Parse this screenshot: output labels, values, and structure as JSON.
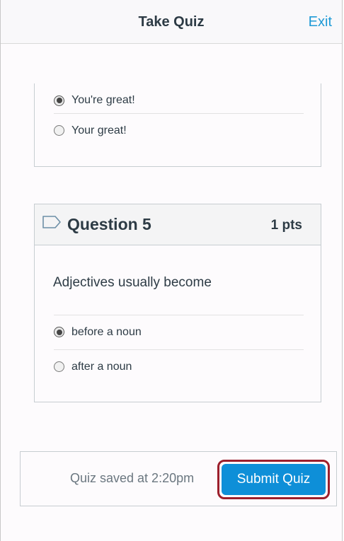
{
  "nav": {
    "title": "Take Quiz",
    "exit_label": "Exit"
  },
  "question4": {
    "answers": [
      {
        "label": "You're great!",
        "selected": true
      },
      {
        "label": "Your great!",
        "selected": false
      }
    ]
  },
  "question5": {
    "title": "Question 5",
    "points": "1 pts",
    "text": "Adjectives usually become",
    "answers": [
      {
        "label": "before a noun",
        "selected": true
      },
      {
        "label": "after a noun",
        "selected": false
      }
    ]
  },
  "footer": {
    "saved_text": "Quiz saved at 2:20pm",
    "submit_label": "Submit Quiz"
  },
  "colors": {
    "accent": "#0e8fd8",
    "link": "#1f9ad6",
    "highlight_ring": "#9c1f2c"
  },
  "icons": {
    "flag": "flag-outline-icon",
    "radio_selected": "radio-selected-icon",
    "radio_unselected": "radio-unselected-icon"
  }
}
